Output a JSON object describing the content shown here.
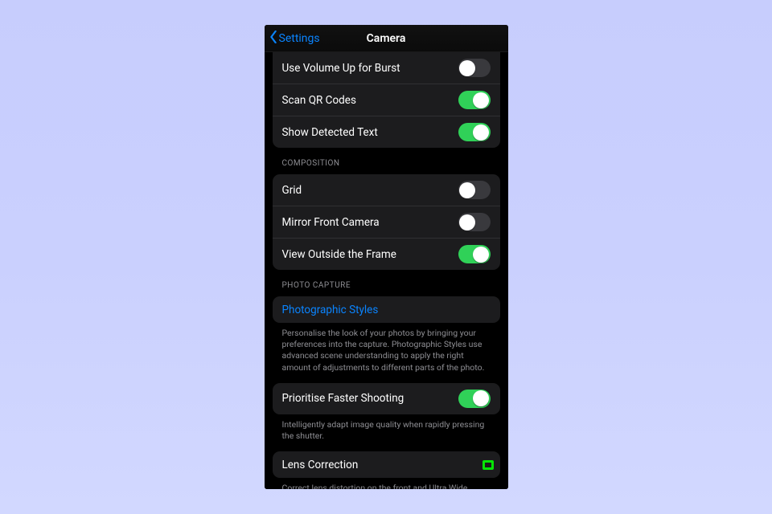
{
  "colors": {
    "accent_blue": "#0a84ff",
    "toggle_on": "#30d158",
    "highlight": "#06e506"
  },
  "nav": {
    "back_label": "Settings",
    "title": "Camera"
  },
  "top_group": {
    "items": [
      {
        "label": "Use Volume Up for Burst",
        "on": false
      },
      {
        "label": "Scan QR Codes",
        "on": true
      },
      {
        "label": "Show Detected Text",
        "on": true
      }
    ]
  },
  "composition": {
    "header": "COMPOSITION",
    "items": [
      {
        "label": "Grid",
        "on": false
      },
      {
        "label": "Mirror Front Camera",
        "on": false
      },
      {
        "label": "View Outside the Frame",
        "on": true
      }
    ]
  },
  "photo_capture": {
    "header": "PHOTO CAPTURE",
    "styles_label": "Photographic Styles",
    "styles_footer": "Personalise the look of your photos by bringing your preferences into the capture. Photographic Styles use advanced scene understanding to apply the right amount of adjustments to different parts of the photo."
  },
  "prioritise": {
    "label": "Prioritise Faster Shooting",
    "on": true,
    "footer": "Intelligently adapt image quality when rapidly pressing the shutter."
  },
  "lens": {
    "label": "Lens Correction",
    "on": true,
    "footer": "Correct lens distortion on the front and Ultra Wide cameras."
  }
}
